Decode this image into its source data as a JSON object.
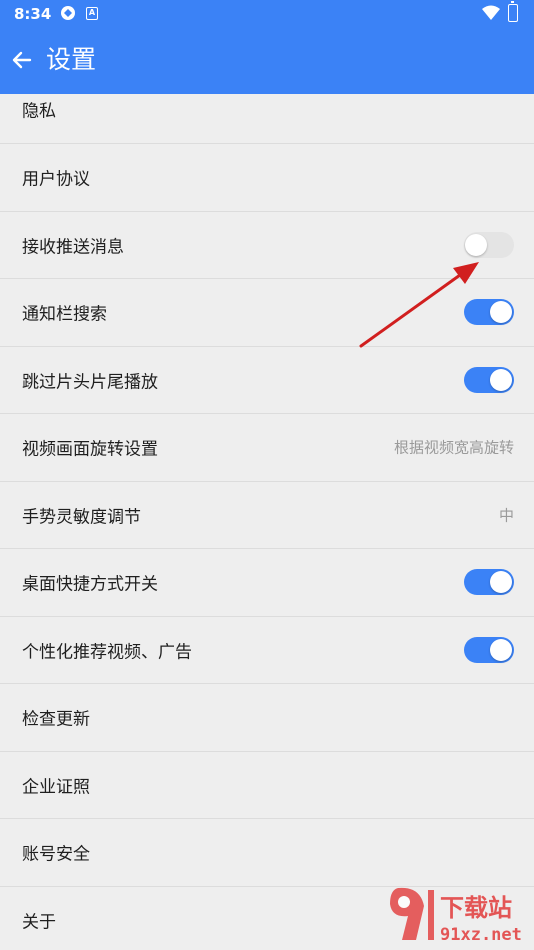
{
  "statusbar": {
    "time": "8:34",
    "badge": "A"
  },
  "appbar": {
    "title": "设置"
  },
  "colors": {
    "accent": "#3b82f6",
    "arrow": "#d11f1f"
  },
  "items": [
    {
      "label": "隐私",
      "type": "link"
    },
    {
      "label": "用户协议",
      "type": "link"
    },
    {
      "label": "接收推送消息",
      "type": "toggle",
      "on": false
    },
    {
      "label": "通知栏搜索",
      "type": "toggle",
      "on": true
    },
    {
      "label": "跳过片头片尾播放",
      "type": "toggle",
      "on": true
    },
    {
      "label": "视频画面旋转设置",
      "type": "value",
      "value": "根据视频宽高旋转"
    },
    {
      "label": "手势灵敏度调节",
      "type": "value",
      "value": "中"
    },
    {
      "label": "桌面快捷方式开关",
      "type": "toggle",
      "on": true
    },
    {
      "label": "个性化推荐视频、广告",
      "type": "toggle",
      "on": true
    },
    {
      "label": "检查更新",
      "type": "link"
    },
    {
      "label": "企业证照",
      "type": "link"
    },
    {
      "label": "账号安全",
      "type": "link"
    },
    {
      "label": "关于",
      "type": "link"
    }
  ],
  "watermark": {
    "brand": "下载站",
    "site": "91xz.net"
  }
}
